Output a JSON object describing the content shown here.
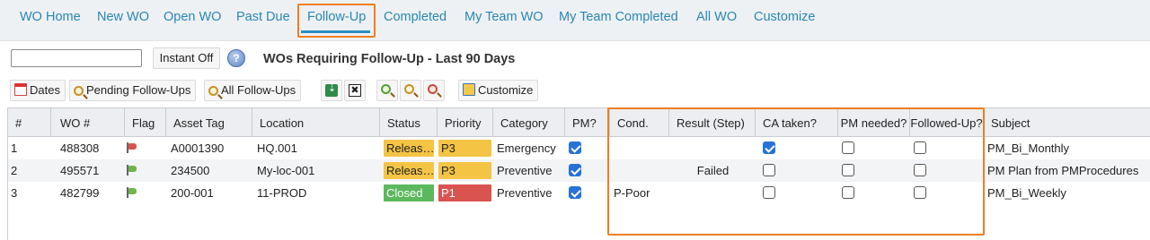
{
  "tabs": [
    {
      "label": "WO Home"
    },
    {
      "label": "New WO"
    },
    {
      "label": "Open WO"
    },
    {
      "label": "Past Due"
    },
    {
      "label": "Follow-Up"
    },
    {
      "label": "Completed"
    },
    {
      "label": "My Team WO"
    },
    {
      "label": "My Team Completed"
    },
    {
      "label": "All WO"
    },
    {
      "label": "Customize"
    }
  ],
  "active_tab": "Follow-Up",
  "search": {
    "value": "",
    "placeholder": ""
  },
  "instant_label": "Instant Off",
  "help_icon_glyph": "?",
  "page_heading": "WOs Requiring Follow-Up - Last 90 Days",
  "toolbar": {
    "dates_label": "Dates",
    "pending_label": "Pending Follow-Ups",
    "all_label": "All Follow-Ups",
    "customize_label": "Customize",
    "clear_glyph": "✖"
  },
  "columns": {
    "num": "#",
    "wo": "WO #",
    "flag": "Flag",
    "asset": "Asset Tag",
    "location": "Location",
    "status": "Status",
    "priority": "Priority",
    "category": "Category",
    "pm": "PM?",
    "cond": "Cond.",
    "result": "Result (Step)",
    "ca": "CA taken?",
    "pmneeded": "PM needed?",
    "followed": "Followed-Up?",
    "subject": "Subject"
  },
  "rows": [
    {
      "num": "1",
      "wo": "488308",
      "flag": "red",
      "asset": "A0001390",
      "location": "HQ.001",
      "status": "Releas…",
      "status_type": "released",
      "priority": "P3",
      "priority_type": "p3",
      "category": "Emergency",
      "pm": true,
      "cond": "",
      "result": "",
      "ca": true,
      "pmneeded": false,
      "followed": false,
      "subject": "PM_Bi_Monthly"
    },
    {
      "num": "2",
      "wo": "495571",
      "flag": "green",
      "asset": "234500",
      "location": "My-loc-001",
      "status": "Releas…",
      "status_type": "released",
      "priority": "P3",
      "priority_type": "p3",
      "category": "Preventive",
      "pm": true,
      "cond": "",
      "result": "Failed",
      "ca": false,
      "pmneeded": false,
      "followed": false,
      "subject": "PM Plan from PMProcedures"
    },
    {
      "num": "3",
      "wo": "482799",
      "flag": "green",
      "asset": "200-001",
      "location": "11-PROD",
      "status": "Closed",
      "status_type": "closed",
      "priority": "P1",
      "priority_type": "p1",
      "category": "Preventive",
      "pm": true,
      "cond": "P-Poor",
      "result": "",
      "ca": false,
      "pmneeded": false,
      "followed": false,
      "subject": "PM_Bi_Weekly"
    }
  ],
  "colors": {
    "accent": "#2a86b4",
    "highlight": "#f07f1f",
    "released": "#f4c445",
    "closed": "#5cb85c",
    "p1": "#d9534f"
  }
}
